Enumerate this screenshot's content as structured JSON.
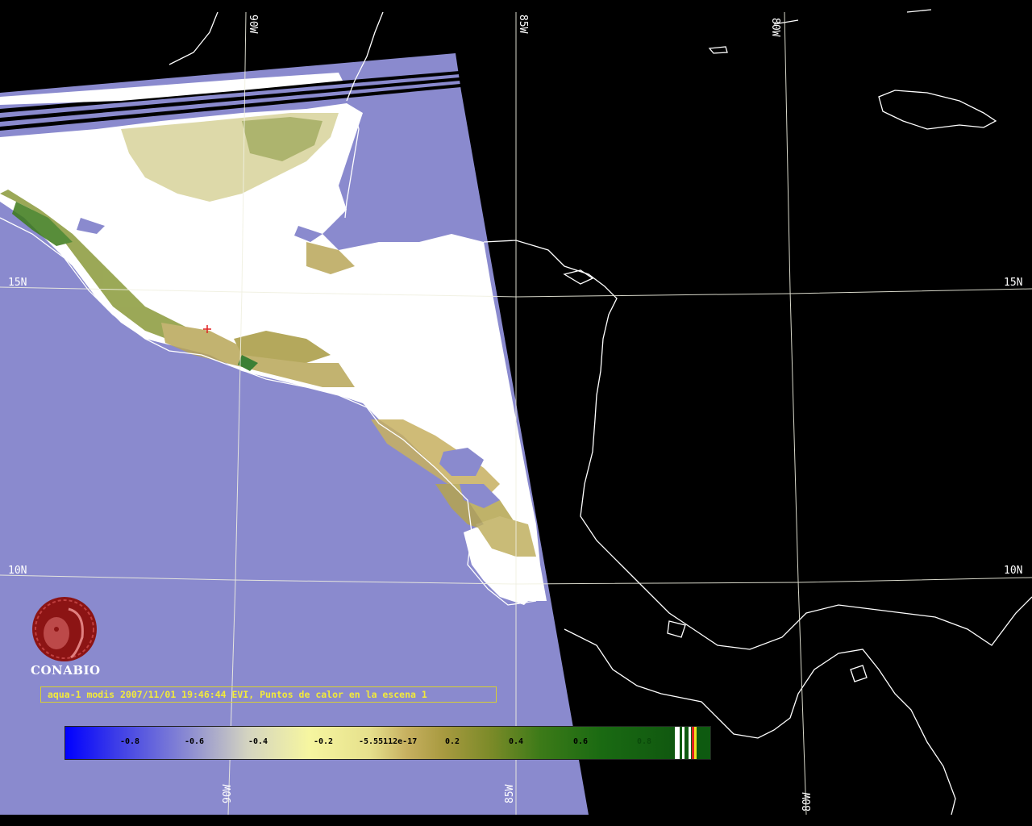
{
  "grid": {
    "lat_labels_left": [
      "15N",
      "10N"
    ],
    "lat_labels_right": [
      "15N",
      "10N"
    ],
    "lon_labels_top": [
      "90W",
      "85W",
      "80W"
    ],
    "lon_labels_bottom": [
      "90W",
      "85W",
      "80W"
    ]
  },
  "logo": {
    "text": "CONABIO"
  },
  "caption": "aqua-1 modis 2007/11/01 19:46:44 EVI, Puntos de calor en la escena 1",
  "colorbar": {
    "labels": [
      "-0.8",
      "-0.6",
      "-0.4",
      "-0.2",
      "-5.55112e-17",
      "0.2",
      "0.4",
      "0.6",
      "0.8"
    ]
  },
  "colors": {
    "ocean": "#8a8ace",
    "cloud": "#ffffff",
    "space": "#000000",
    "coastline": "#ffffff",
    "gridline": "#f0f0e0",
    "caption_text": "#f2ea3a",
    "logo": "#8c1414"
  }
}
